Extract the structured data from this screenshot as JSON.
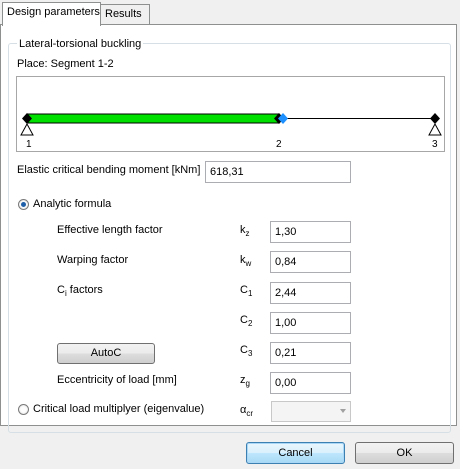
{
  "tabs": [
    {
      "label": "Design parameters",
      "active": true
    },
    {
      "label": "Results",
      "active": false
    }
  ],
  "group": {
    "title": "Lateral-torsional buckling"
  },
  "place": "Place: Segment 1-2",
  "beam": {
    "nodes": [
      "1",
      "2",
      "3"
    ],
    "segment_color": "#00e000",
    "node_color": "#000000",
    "highlight_color": "#1e90ff"
  },
  "mcr": {
    "label": "Elastic critical bending moment [kNm]",
    "value": "618,31"
  },
  "analytic": {
    "label": "Analytic formula",
    "checked": true
  },
  "params": {
    "kz": {
      "label": "Effective length factor",
      "symbol": "k",
      "sub": "z",
      "value": "1,30"
    },
    "kw": {
      "label": "Warping factor",
      "symbol": "k",
      "sub": "w",
      "value": "0,84"
    },
    "c1": {
      "label": "C",
      "label_sub": "i",
      "label_rest": " factors",
      "symbol": "C",
      "sub": "1",
      "value": "2,44"
    },
    "c2": {
      "symbol": "C",
      "sub": "2",
      "value": "1,00"
    },
    "c3": {
      "symbol": "C",
      "sub": "3",
      "value": "0,21"
    },
    "zg": {
      "label": "Eccentricity of load [mm]",
      "symbol": "z",
      "sub": "g",
      "value": "0,00"
    }
  },
  "autoc_label": "AutoC",
  "eigen": {
    "label": "Critical load multiplyer (eigenvalue)",
    "symbol": "α",
    "sub": "cr",
    "checked": false,
    "value": ""
  },
  "buttons": {
    "cancel": "Cancel",
    "ok": "OK"
  }
}
